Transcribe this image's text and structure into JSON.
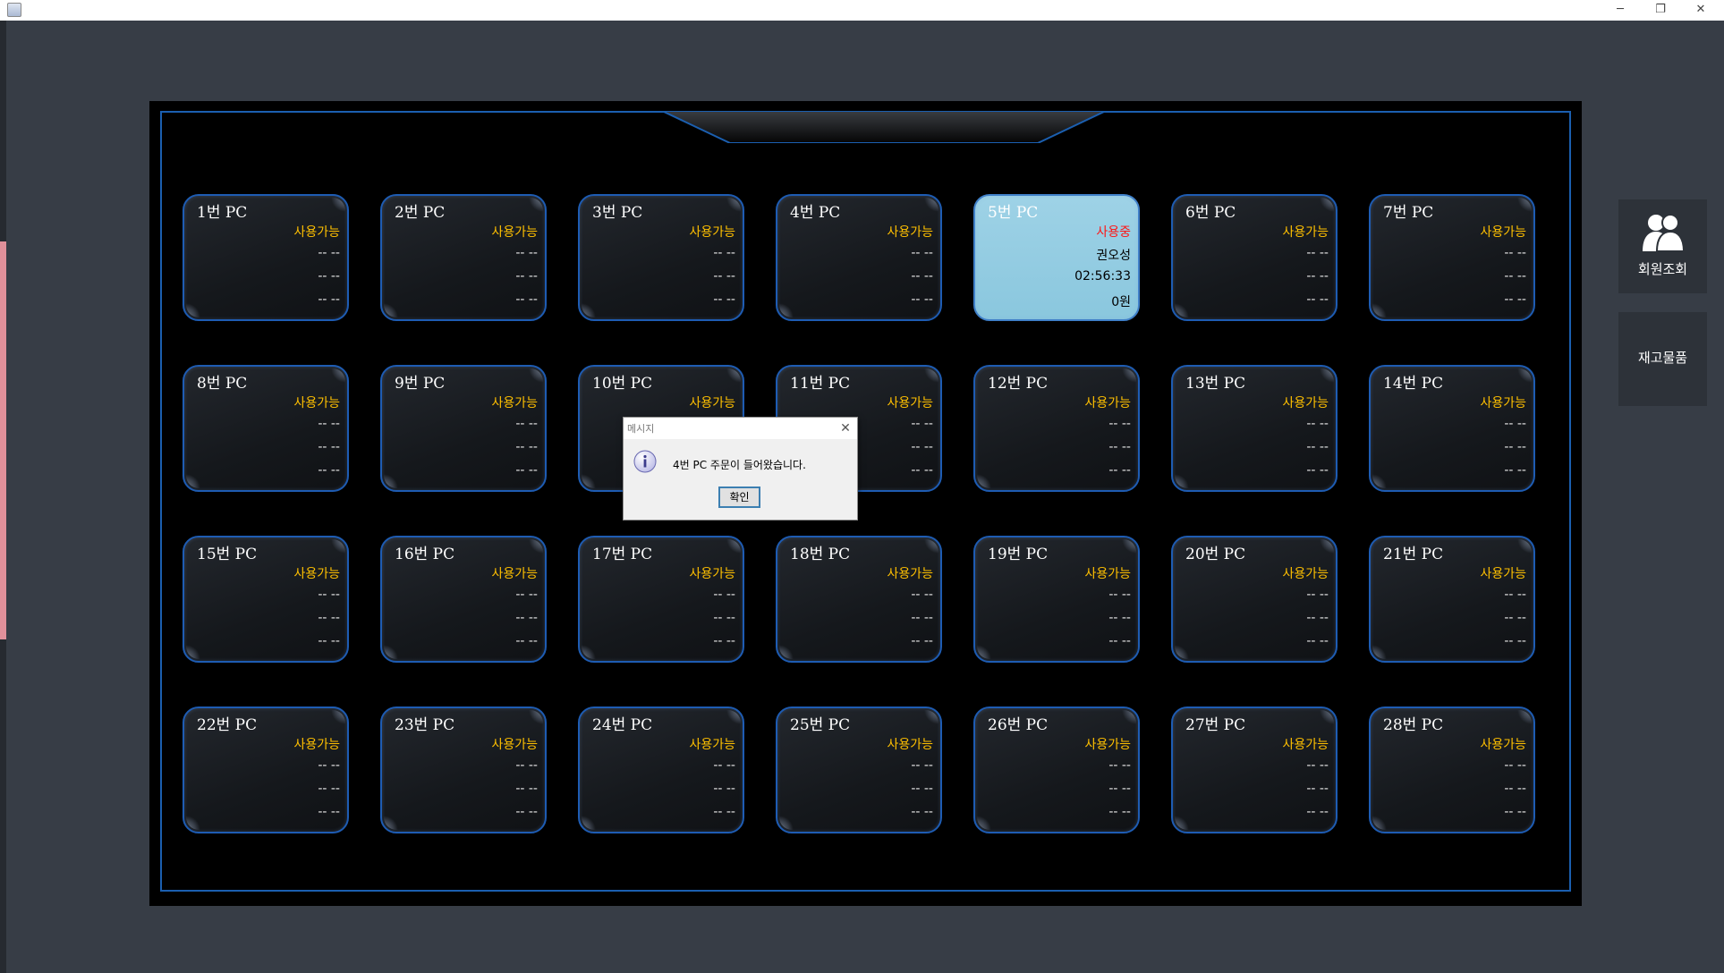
{
  "window": {
    "minimize_glyph": "─",
    "maximize_glyph": "❐",
    "close_glyph": "✕"
  },
  "pcs": [
    {
      "name": "1번 PC",
      "status": "사용가능",
      "line2": "-- --",
      "line3": "-- --",
      "line4": "-- --",
      "active": false
    },
    {
      "name": "2번 PC",
      "status": "사용가능",
      "line2": "-- --",
      "line3": "-- --",
      "line4": "-- --",
      "active": false
    },
    {
      "name": "3번 PC",
      "status": "사용가능",
      "line2": "-- --",
      "line3": "-- --",
      "line4": "-- --",
      "active": false
    },
    {
      "name": "4번 PC",
      "status": "사용가능",
      "line2": "-- --",
      "line3": "-- --",
      "line4": "-- --",
      "active": false
    },
    {
      "name": "5번 PC",
      "status": "사용중",
      "line2": "권오성",
      "line3": "02:56:33",
      "line4": "0원",
      "active": true
    },
    {
      "name": "6번 PC",
      "status": "사용가능",
      "line2": "-- --",
      "line3": "-- --",
      "line4": "-- --",
      "active": false
    },
    {
      "name": "7번 PC",
      "status": "사용가능",
      "line2": "-- --",
      "line3": "-- --",
      "line4": "-- --",
      "active": false
    },
    {
      "name": "8번 PC",
      "status": "사용가능",
      "line2": "-- --",
      "line3": "-- --",
      "line4": "-- --",
      "active": false
    },
    {
      "name": "9번 PC",
      "status": "사용가능",
      "line2": "-- --",
      "line3": "-- --",
      "line4": "-- --",
      "active": false
    },
    {
      "name": "10번 PC",
      "status": "사용가능",
      "line2": "-- --",
      "line3": "-- --",
      "line4": "-- --",
      "active": false
    },
    {
      "name": "11번 PC",
      "status": "사용가능",
      "line2": "-- --",
      "line3": "-- --",
      "line4": "-- --",
      "active": false
    },
    {
      "name": "12번 PC",
      "status": "사용가능",
      "line2": "-- --",
      "line3": "-- --",
      "line4": "-- --",
      "active": false
    },
    {
      "name": "13번 PC",
      "status": "사용가능",
      "line2": "-- --",
      "line3": "-- --",
      "line4": "-- --",
      "active": false
    },
    {
      "name": "14번 PC",
      "status": "사용가능",
      "line2": "-- --",
      "line3": "-- --",
      "line4": "-- --",
      "active": false
    },
    {
      "name": "15번 PC",
      "status": "사용가능",
      "line2": "-- --",
      "line3": "-- --",
      "line4": "-- --",
      "active": false
    },
    {
      "name": "16번 PC",
      "status": "사용가능",
      "line2": "-- --",
      "line3": "-- --",
      "line4": "-- --",
      "active": false
    },
    {
      "name": "17번 PC",
      "status": "사용가능",
      "line2": "-- --",
      "line3": "-- --",
      "line4": "-- --",
      "active": false
    },
    {
      "name": "18번 PC",
      "status": "사용가능",
      "line2": "-- --",
      "line3": "-- --",
      "line4": "-- --",
      "active": false
    },
    {
      "name": "19번 PC",
      "status": "사용가능",
      "line2": "-- --",
      "line3": "-- --",
      "line4": "-- --",
      "active": false
    },
    {
      "name": "20번 PC",
      "status": "사용가능",
      "line2": "-- --",
      "line3": "-- --",
      "line4": "-- --",
      "active": false
    },
    {
      "name": "21번 PC",
      "status": "사용가능",
      "line2": "-- --",
      "line3": "-- --",
      "line4": "-- --",
      "active": false
    },
    {
      "name": "22번 PC",
      "status": "사용가능",
      "line2": "-- --",
      "line3": "-- --",
      "line4": "-- --",
      "active": false
    },
    {
      "name": "23번 PC",
      "status": "사용가능",
      "line2": "-- --",
      "line3": "-- --",
      "line4": "-- --",
      "active": false
    },
    {
      "name": "24번 PC",
      "status": "사용가능",
      "line2": "-- --",
      "line3": "-- --",
      "line4": "-- --",
      "active": false
    },
    {
      "name": "25번 PC",
      "status": "사용가능",
      "line2": "-- --",
      "line3": "-- --",
      "line4": "-- --",
      "active": false
    },
    {
      "name": "26번 PC",
      "status": "사용가능",
      "line2": "-- --",
      "line3": "-- --",
      "line4": "-- --",
      "active": false
    },
    {
      "name": "27번 PC",
      "status": "사용가능",
      "line2": "-- --",
      "line3": "-- --",
      "line4": "-- --",
      "active": false
    },
    {
      "name": "28번 PC",
      "status": "사용가능",
      "line2": "-- --",
      "line3": "-- --",
      "line4": "-- --",
      "active": false
    }
  ],
  "sidebar": {
    "member_label": "회원조회",
    "member_icon": "users-icon",
    "stock_label": "재고물품"
  },
  "dialog": {
    "title": "메시지",
    "message": "4번 PC 주문이 들어왔습니다.",
    "ok_label": "확인",
    "close_glyph": "✕",
    "icon": "info-icon"
  },
  "colors": {
    "available_status": "#ffc000",
    "in_use_status": "#ff1414",
    "active_card": "#9ed2e6",
    "card_border": "#1e5cb3",
    "panel": "#000000",
    "background": "#373d46"
  }
}
